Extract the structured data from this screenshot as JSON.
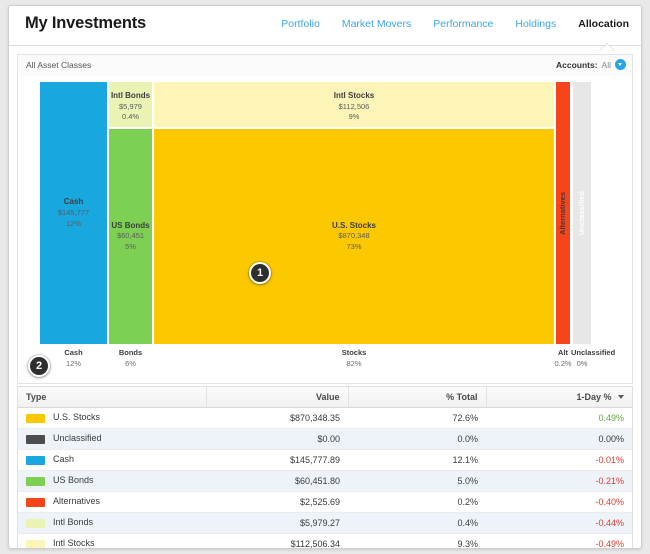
{
  "header": {
    "title": "My Investments",
    "nav": [
      {
        "label": "Portfolio",
        "active": false
      },
      {
        "label": "Market Movers",
        "active": false
      },
      {
        "label": "Performance",
        "active": false
      },
      {
        "label": "Holdings",
        "active": false
      },
      {
        "label": "Allocation",
        "active": true
      }
    ]
  },
  "subbar": {
    "asset_classes": "All Asset Classes",
    "accounts_label": "Accounts:",
    "accounts_value": "All",
    "accounts_icon": "chevron-down-circle-icon"
  },
  "badges": [
    {
      "id": "1",
      "label": "1"
    },
    {
      "id": "2",
      "label": "2"
    }
  ],
  "colors": {
    "cash": "#19a7e0",
    "us_bonds": "#7ed055",
    "intl_bonds": "#eaf3b4",
    "us_stocks": "#fcc800",
    "intl_stocks": "#fdf5b8",
    "alternatives": "#f8441a",
    "unclassified": "#e7e7e7",
    "unclassified_swatch": "#4d4d4d",
    "positive": "#5fae3a",
    "negative": "#e23b2e",
    "accent_blue": "#3ea6e8"
  },
  "chart_data": {
    "type": "treemap",
    "title": "",
    "tiles": [
      {
        "name": "Cash",
        "value_label": "$145,777",
        "pct_label": "12%",
        "value": 145777,
        "pct": 12
      },
      {
        "name": "Intl Bonds",
        "value_label": "$5,979",
        "pct_label": "0.4%",
        "value": 5979,
        "pct": 0.4
      },
      {
        "name": "US Bonds",
        "value_label": "$60,451",
        "pct_label": "5%",
        "value": 60451,
        "pct": 5
      },
      {
        "name": "Intl Stocks",
        "value_label": "$112,506",
        "pct_label": "9%",
        "value": 112506,
        "pct": 9
      },
      {
        "name": "U.S. Stocks",
        "value_label": "$870,348",
        "pct_label": "73%",
        "value": 870348,
        "pct": 73
      },
      {
        "name": "Alternatives",
        "value_label": "$2,526",
        "pct_label": "0.2%",
        "value": 2526,
        "pct": 0.2
      },
      {
        "name": "Unclassified",
        "value_label": "$0",
        "pct_label": "0%",
        "value": 0,
        "pct": 0
      }
    ],
    "axis_groups": [
      {
        "name": "Cash",
        "pct": "12%"
      },
      {
        "name": "Bonds",
        "pct": "6%"
      },
      {
        "name": "Stocks",
        "pct": "82%"
      },
      {
        "name": "Alt",
        "pct": "0.2%"
      },
      {
        "name": "Unclassified",
        "pct": "0%"
      }
    ]
  },
  "table": {
    "columns": [
      {
        "key": "type",
        "label": "Type"
      },
      {
        "key": "value",
        "label": "Value"
      },
      {
        "key": "pct",
        "label": "% Total"
      },
      {
        "key": "day",
        "label": "1-Day %",
        "sorted": "desc"
      }
    ],
    "rows": [
      {
        "type": "U.S. Stocks",
        "value": "$870,348.35",
        "pct": "72.6%",
        "day": "0.49%",
        "day_sign": "pos"
      },
      {
        "type": "Unclassified",
        "value": "$0.00",
        "pct": "0.0%",
        "day": "0.00%",
        "day_sign": "neu"
      },
      {
        "type": "Cash",
        "value": "$145,777.89",
        "pct": "12.1%",
        "day": "-0.01%",
        "day_sign": "neg"
      },
      {
        "type": "US Bonds",
        "value": "$60,451.80",
        "pct": "5.0%",
        "day": "-0.21%",
        "day_sign": "neg"
      },
      {
        "type": "Alternatives",
        "value": "$2,525.69",
        "pct": "0.2%",
        "day": "-0.40%",
        "day_sign": "neg"
      },
      {
        "type": "Intl Bonds",
        "value": "$5,979.27",
        "pct": "0.4%",
        "day": "-0.44%",
        "day_sign": "neg"
      },
      {
        "type": "Intl Stocks",
        "value": "$112,506.34",
        "pct": "9.3%",
        "day": "-0.49%",
        "day_sign": "neg"
      }
    ]
  }
}
